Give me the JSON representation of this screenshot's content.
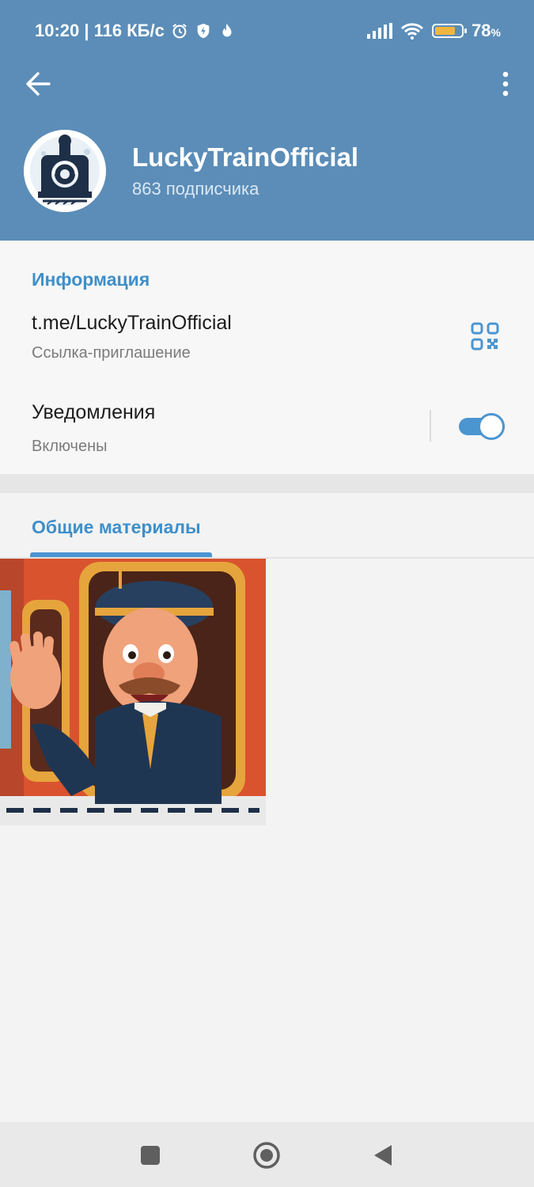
{
  "status_bar": {
    "time_speed": "10:20 | 116 КБ/с",
    "battery_percent": "78",
    "battery_percent_suffix": "%",
    "battery_level": 0.78
  },
  "header": {
    "channel_name": "LuckyTrainOfficial",
    "subscribers": "863 подписчика"
  },
  "info": {
    "section_title": "Информация",
    "link": "t.me/LuckyTrainOfficial",
    "link_caption": "Ссылка-приглашение",
    "notifications_label": "Уведомления",
    "notifications_state": "Включены",
    "notifications_on": true
  },
  "media": {
    "tab_label": "Общие материалы",
    "items": [
      {
        "type": "image",
        "icon": "conductor-waving-image"
      }
    ]
  },
  "colors": {
    "header": "#5b8db8",
    "accent": "#4b95d1",
    "section_title": "#3f8fc9"
  },
  "nav": {
    "icons": [
      "recents-square-icon",
      "home-circle-icon",
      "back-triangle-icon"
    ]
  }
}
